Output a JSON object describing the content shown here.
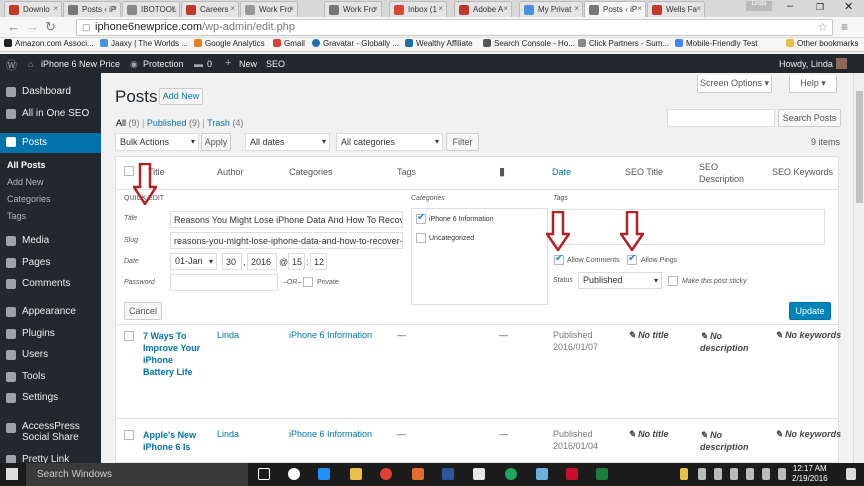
{
  "browser": {
    "tabs": [
      {
        "label": "Downlo",
        "color": "#c0392b"
      },
      {
        "label": "Posts ‹ iP",
        "color": "#777"
      },
      {
        "label": "IBOTOOL",
        "color": "#888"
      },
      {
        "label": "Careers",
        "color": "#c0392b"
      },
      {
        "label": "Work Fro",
        "color": "#999"
      },
      {
        "label": "Work Fro",
        "color": "#777"
      },
      {
        "label": "Inbox (1",
        "color": "#d44638"
      },
      {
        "label": "Adobe A",
        "color": "#c0392b"
      },
      {
        "label": "My Privat",
        "color": "#4a90d9"
      },
      {
        "label": "Posts ‹ iP",
        "color": "#777"
      },
      {
        "label": "Wells Fa",
        "color": "#c0392b"
      }
    ],
    "user_box": "Linda",
    "url_host": "iphone6newprice.com",
    "url_path": "/wp-admin/edit.php",
    "bookmarks": [
      {
        "label": "Amazon.com Associ...",
        "color": "#222"
      },
      {
        "label": "Jaaxy | The Worlds ...",
        "color": "#4a90d9"
      },
      {
        "label": "Google Analytics",
        "color": "#e67e22"
      },
      {
        "label": "Gmail",
        "color": "#d44638"
      },
      {
        "label": "Gravatar - Globally ...",
        "color": "#1e6fa8"
      },
      {
        "label": "Wealthy Affiliate",
        "color": "#1e6fa8"
      },
      {
        "label": "Search Console - Ho...",
        "color": "#555"
      },
      {
        "label": "Click Partners - Sum...",
        "color": "#888"
      },
      {
        "label": "Mobile-Friendly Test",
        "color": "#4285f4"
      },
      {
        "label": "Other bookmarks",
        "color": "#e6c24a"
      }
    ]
  },
  "adminbar": {
    "site_name": "iPhone 6 New Price",
    "protection": "Protection",
    "comments_count": "0",
    "new_label": "New",
    "seo_label": "SEO",
    "howdy": "Howdy, Linda"
  },
  "sidebar": {
    "items": [
      {
        "label": "Dashboard"
      },
      {
        "label": "All in One SEO"
      },
      {
        "label": "Posts"
      },
      {
        "label": "Media"
      },
      {
        "label": "Pages"
      },
      {
        "label": "Comments"
      },
      {
        "label": "Appearance"
      },
      {
        "label": "Plugins"
      },
      {
        "label": "Users"
      },
      {
        "label": "Tools"
      },
      {
        "label": "Settings"
      },
      {
        "label": "AccessPress Social Share"
      },
      {
        "label": "Pretty Link"
      }
    ],
    "subitems": [
      {
        "label": "All Posts"
      },
      {
        "label": "Add New"
      },
      {
        "label": "Categories"
      },
      {
        "label": "Tags"
      }
    ]
  },
  "page": {
    "title": "Posts",
    "add_new": "Add New",
    "screen_options": "Screen Options ▾",
    "help": "Help ▾",
    "filter_all": "All",
    "filter_all_count": "(9)",
    "filter_published": "Published",
    "filter_published_count": "(9)",
    "filter_trash": "Trash",
    "filter_trash_count": "(4)",
    "sep": "|",
    "search_posts": "Search Posts",
    "bulk_actions": "Bulk Actions",
    "apply": "Apply",
    "all_dates": "All dates",
    "all_categories": "All categories",
    "filter": "Filter",
    "items_count": "9 items"
  },
  "table": {
    "columns": [
      "Title",
      "Author",
      "Categories",
      "Tags",
      "Date",
      "SEO Title",
      "SEO Description",
      "SEO Keywords"
    ],
    "comment_icon": "comment-icon"
  },
  "quickedit": {
    "heading": "QUICK EDIT",
    "title_label": "Title",
    "title_value": "Reasons You Might Lose iPhone Data And How To Recover It",
    "slug_label": "Slug",
    "slug_value": "reasons-you-might-lose-iphone-data-and-how-to-recover-it",
    "date_label": "Date",
    "month": "01-Jan",
    "day": "30",
    "comma": ",",
    "year": "2016",
    "at": "@",
    "hour": "15",
    "colon": ":",
    "minute": "12",
    "password_label": "Password",
    "password_value": "",
    "or": "–OR–",
    "private_label": "Private",
    "categories_label": "Categories",
    "categories": [
      {
        "label": "iPhone 6 Information",
        "checked": true
      },
      {
        "label": "Uncategorized",
        "checked": false
      }
    ],
    "tags_label": "Tags",
    "allow_comments": "Allow Comments",
    "allow_pings": "Allow Pings",
    "status_label": "Status",
    "status_value": "Published",
    "sticky_label": "Make this post sticky",
    "cancel": "Cancel",
    "update": "Update"
  },
  "rows": [
    {
      "title": "7 Ways To Improve Your iPhone Battery Life",
      "title_lines": [
        "7 Ways To",
        "Improve Your",
        "iPhone",
        "Battery Life"
      ],
      "author": "Linda",
      "category": "iPhone 6 Information",
      "tags": "—",
      "comments": "—",
      "status": "Published",
      "date": "2016/01/07",
      "seo_title": "No title",
      "seo_desc_lines": [
        "No",
        "description"
      ],
      "seo_keywords": "No keywords"
    },
    {
      "title": "Apple's New iPhone 6 Is",
      "title_lines": [
        "Apple's New",
        "iPhone 6 Is"
      ],
      "author": "Linda",
      "category": "iPhone 6 Information",
      "tags": "—",
      "comments": "—",
      "status": "Published",
      "date": "2016/01/04",
      "seo_title": "No title",
      "seo_desc_lines": [
        "No",
        "description"
      ],
      "seo_keywords": "No keywords"
    }
  ],
  "taskbar": {
    "search": "Search Windows",
    "time": "12:17 AM",
    "date": "2/19/2016"
  },
  "colors": {
    "accent": "#0073aa",
    "admin_dark": "#23282d",
    "arrow_red": "#b22222"
  }
}
